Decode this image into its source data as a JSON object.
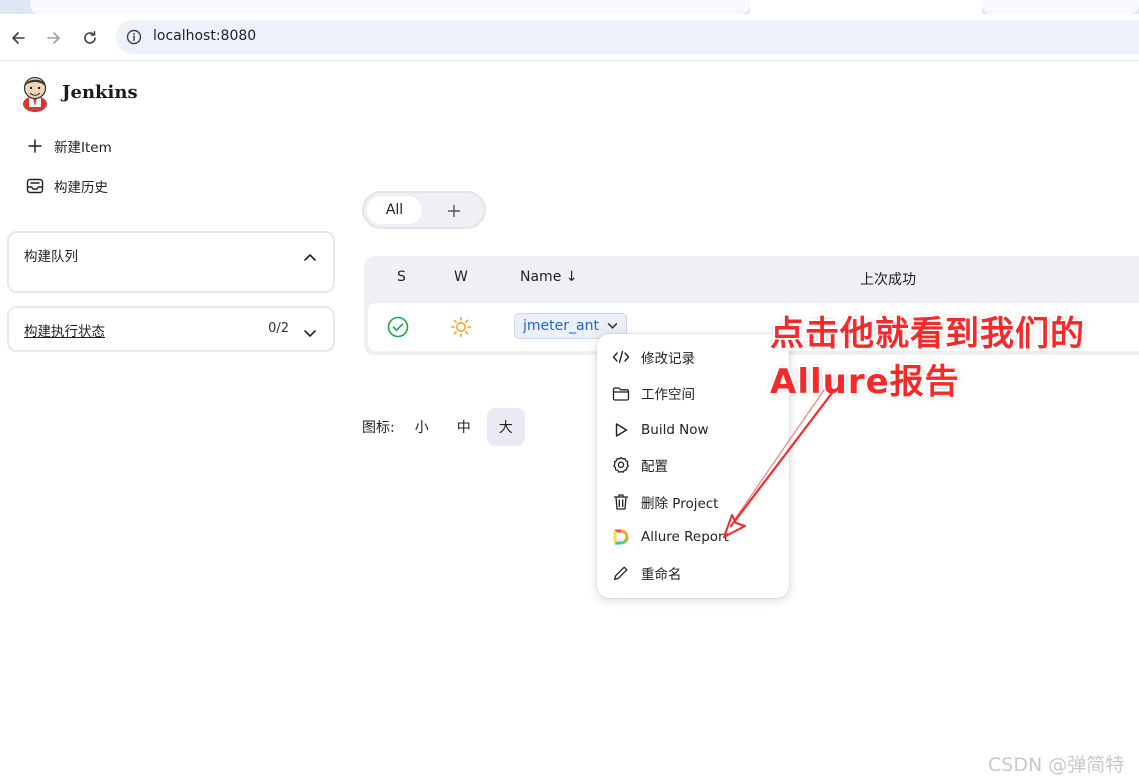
{
  "browser": {
    "url": "localhost:8080"
  },
  "header": {
    "brand": "Jenkins"
  },
  "sidebar": {
    "new_item_label": "新建Item",
    "build_history_label": "构建历史",
    "build_queue": {
      "title": "构建队列"
    },
    "executor_status": {
      "title": "构建执行状态",
      "count": "0/2"
    }
  },
  "views": {
    "tabs": [
      {
        "label": "All"
      }
    ]
  },
  "table": {
    "columns": {
      "status": "S",
      "weather": "W",
      "name": "Name ↓",
      "last_success": "上次成功"
    },
    "rows": [
      {
        "name": "jmeter_ant",
        "status_icon": "check-circle-icon",
        "weather_icon": "sun-icon"
      }
    ]
  },
  "icon_size": {
    "label": "图标:",
    "options": [
      "小",
      "中",
      "大"
    ],
    "selected": "大"
  },
  "context_menu": {
    "items": [
      {
        "label": "修改记录",
        "icon": "code-icon"
      },
      {
        "label": "工作空间",
        "icon": "folder-icon"
      },
      {
        "label": "Build Now",
        "icon": "play-icon"
      },
      {
        "label": "配置",
        "icon": "gear-icon"
      },
      {
        "label": "删除 Project",
        "icon": "trash-icon"
      },
      {
        "label": "Allure Report",
        "icon": "allure-logo-icon"
      },
      {
        "label": "重命名",
        "icon": "pencil-icon"
      }
    ]
  },
  "annotation": {
    "line1": "点击他就看到我们的",
    "line2": "Allure报告",
    "color": "#f42a2a"
  },
  "watermark": "CSDN @弹简特",
  "colors": {
    "link": "#1f67d2",
    "success": "#1ea64a",
    "sun": "#f6a623"
  }
}
